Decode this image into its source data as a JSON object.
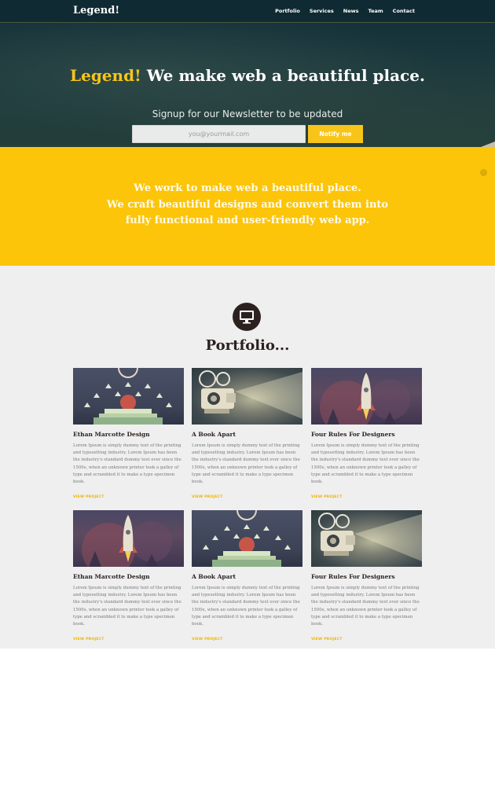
{
  "nav": {
    "brand": "Legend!",
    "items": [
      {
        "label": "Portfolio"
      },
      {
        "label": "Services"
      },
      {
        "label": "News"
      },
      {
        "label": "Team"
      },
      {
        "label": "Contact"
      }
    ]
  },
  "hero": {
    "title_accent": "Legend!",
    "title_rest": " We make web a beautiful place.",
    "signup_text": "Signup for our Newsletter to be updated",
    "email_placeholder": "you@yourmail.com",
    "notify_label": "Notify me"
  },
  "band": {
    "line1": "We work to make web a beautiful place.",
    "line2": "We craft beautiful designs and convert them into",
    "line3": "fully functional and user-friendly web app.",
    "arrow_icon": "chevron-right-icon"
  },
  "portfolio": {
    "heading": "Portfolio...",
    "icon": "monitor-icon",
    "cards": [
      {
        "title": "Ethan Marcotte Design",
        "text": "Lorem Ipsum is simply dummy text of the printing and typesetting industry. Lorem Ipsum has been the industry's standard dummy text ever since the 1500s, when an unknown printer took a galley of type and scrambled it to make a type specimen book.",
        "link": "VIEW PROJECT",
        "art": "stage"
      },
      {
        "title": "A Book Apart",
        "text": "Lorem Ipsum is simply dummy text of the printing and typesetting industry. Lorem Ipsum has been the industry's standard dummy text ever since the 1500s, when an unknown printer took a galley of type and scrambled it to make a type specimen book.",
        "link": "VIEW PROJECT",
        "art": "projector"
      },
      {
        "title": "Four Rules For Designers",
        "text": "Lorem Ipsum is simply dummy text of the printing and typesetting industry. Lorem Ipsum has been the industry's standard dummy text ever since the 1500s, when an unknown printer took a galley of type and scrambled it to make a type specimen book.",
        "link": "VIEW PROJECT",
        "art": "rocket"
      },
      {
        "title": "Ethan Marcotte Design",
        "text": "Lorem Ipsum is simply dummy text of the printing and typesetting industry. Lorem Ipsum has been the industry's standard dummy text ever since the 1500s, when an unknown printer took a galley of type and scrambled it to make a type specimen book.",
        "link": "VIEW PROJECT",
        "art": "rocket"
      },
      {
        "title": "A Book Apart",
        "text": "Lorem Ipsum is simply dummy text of the printing and typesetting industry. Lorem Ipsum has been the industry's standard dummy text ever since the 1500s, when an unknown printer took a galley of type and scrambled it to make a type specimen book.",
        "link": "VIEW PROJECT",
        "art": "stage"
      },
      {
        "title": "Four Rules For Designers",
        "text": "Lorem Ipsum is simply dummy text of the printing and typesetting industry. Lorem Ipsum has been the industry's standard dummy text ever since the 1500s, when an unknown printer took a galley of type and scrambled it to make a type specimen book.",
        "link": "VIEW PROJECT",
        "art": "projector"
      }
    ]
  },
  "colors": {
    "accent": "#f7c51a",
    "band": "#fcc509",
    "nav": "#0f2a33",
    "dark": "#2b2220"
  }
}
